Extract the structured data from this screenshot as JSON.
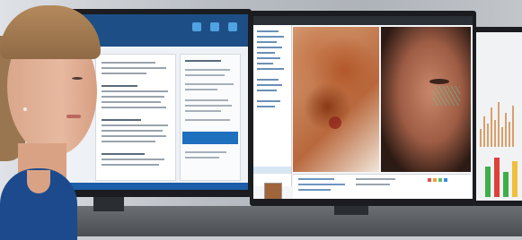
{
  "scene": {
    "description_free": true
  },
  "colors": {
    "app_header_blue": "#1d4f86",
    "selection_blue": "#1f6fbf",
    "blouse_blue": "#1c4a8c"
  },
  "icons": [
    "monitor-left",
    "monitor-center",
    "monitor-right",
    "woman-portrait"
  ]
}
